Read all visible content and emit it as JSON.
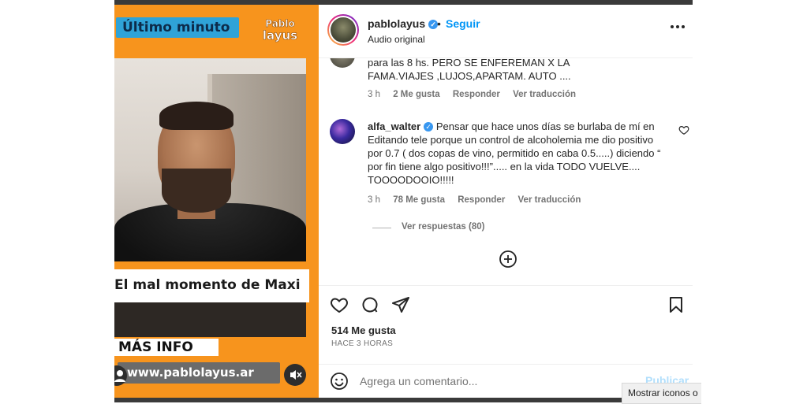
{
  "video": {
    "tag": "Último minuto",
    "logo_line1": "Pablo",
    "logo_line2": "layus",
    "headline": "El mal momento de Maxi",
    "more_info": "MÁS INFO",
    "url": "www.pablolayus.ar"
  },
  "header": {
    "username": "pablolayus",
    "dot": "•",
    "follow_label": "Seguir",
    "subtitle": "Audio original"
  },
  "comments": [
    {
      "text": "para las 8 hs. PERO SE ENFEREMAN X LA FAMA.VIAJES ,LUJOS,APARTAM. AUTO ....",
      "time": "3 h",
      "likes": "2 Me gusta",
      "reply": "Responder",
      "translate": "Ver traducción"
    },
    {
      "username": "alfa_walter",
      "text": "Pensar que hace unos días se burlaba de mí en Editando tele porque un control de alcoholemia me dio positivo por 0.7 ( dos copas de vino, permitido en caba 0.5.....) diciendo “ por fin tiene algo positivo!!!”..... en la vida TODO VUELVE.... TOOOODOOIO!!!!!",
      "time": "3 h",
      "likes": "78 Me gusta",
      "reply": "Responder",
      "translate": "Ver traducción",
      "view_replies": "Ver respuestas (80)"
    }
  ],
  "post": {
    "likes": "514 Me gusta",
    "time_ago": "HACE 3 HORAS"
  },
  "add_comment": {
    "placeholder": "Agrega un comentario...",
    "publish_label": "Publicar"
  },
  "tooltip": "Mostrar iconos o",
  "colors": {
    "video_orange": "#f7941d",
    "accent_blue": "#0095f6",
    "verified_blue": "#3897f0",
    "tag_blue": "#2fa3d8"
  },
  "icons": [
    "verified-badge-icon",
    "more-options-icon",
    "heart-icon",
    "comment-icon",
    "share-icon",
    "bookmark-icon",
    "add-circle-icon",
    "emoji-icon",
    "mute-icon",
    "user-icon"
  ]
}
